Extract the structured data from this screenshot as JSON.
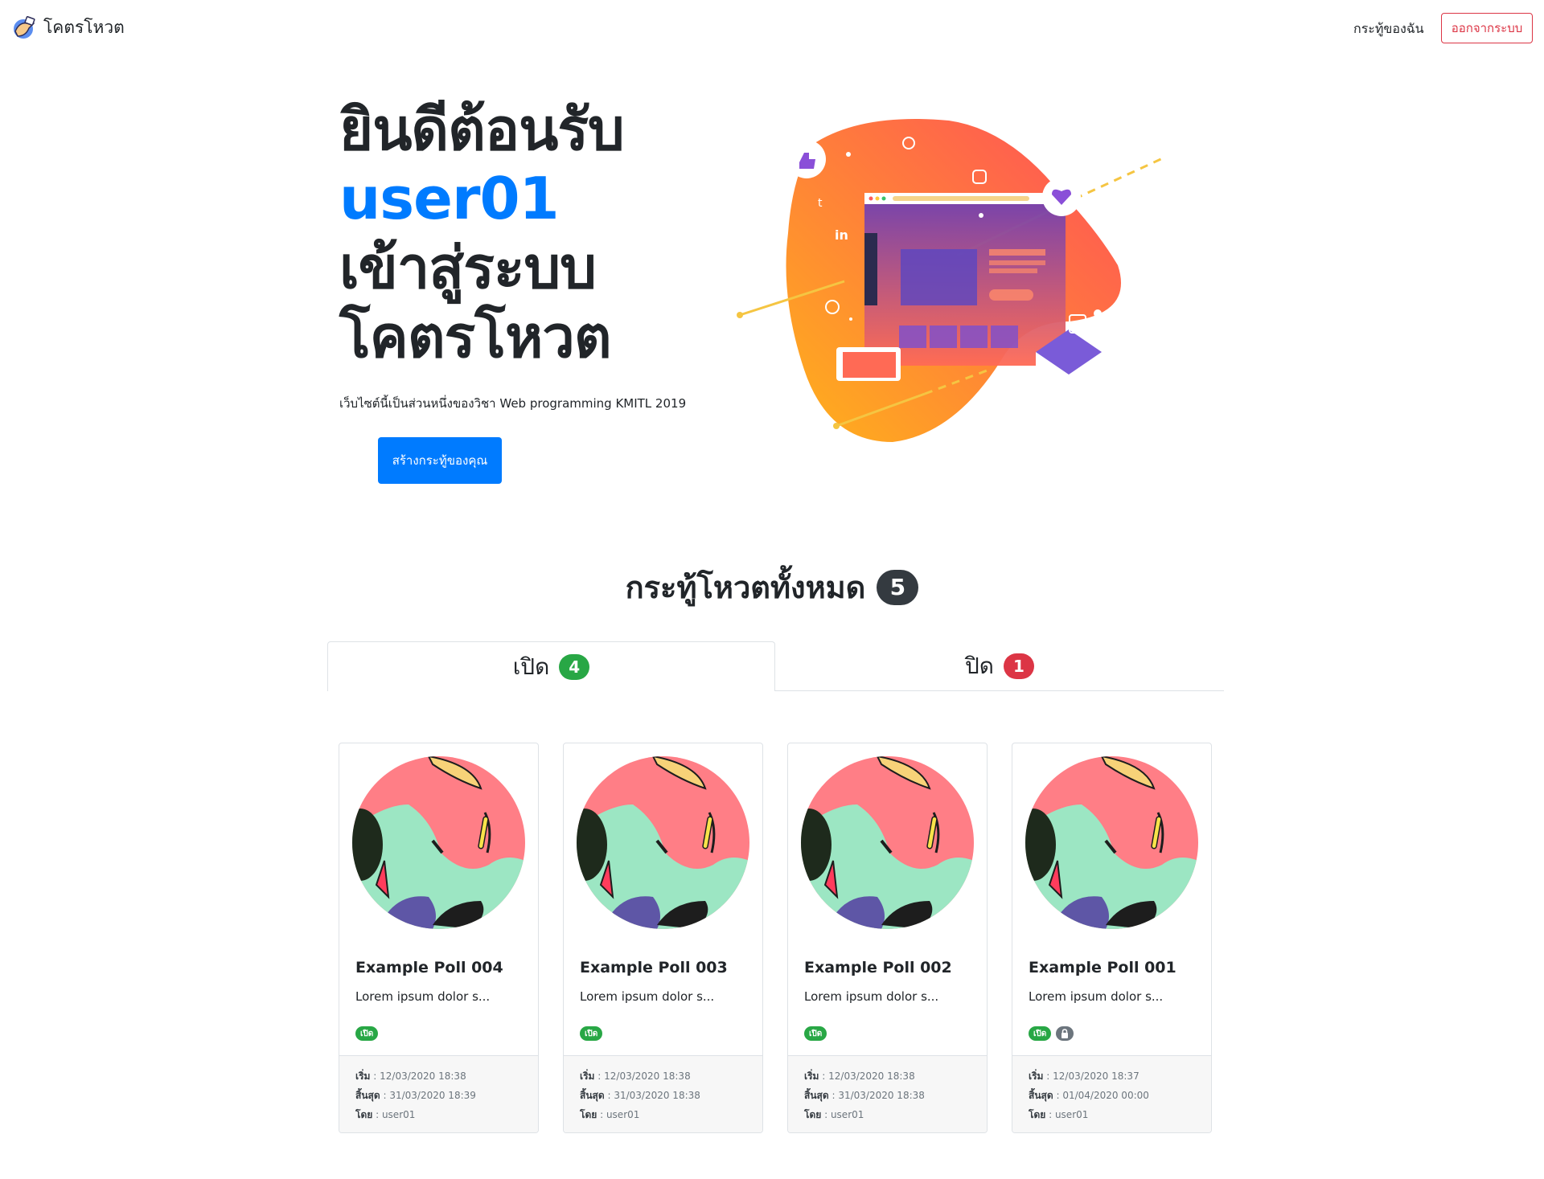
{
  "navbar": {
    "brand": "โคตรโหวต",
    "my_polls": "กระทู้ของฉัน",
    "logout": "ออกจากระบบ"
  },
  "hero": {
    "line1": "ยินดีต้อนรับ",
    "username": "user01",
    "line3": "เข้าสู่ระบบ",
    "line4": "โคตรโหวต",
    "subtitle": "เว็บไซต์นี้เป็นส่วนหนึ่งของวิชา Web programming KMITL 2019",
    "create_button": "สร้างกระทู้ของคุณ"
  },
  "section": {
    "title": "กระทู้โหวตทั้งหมด",
    "total": "5"
  },
  "tabs": [
    {
      "label": "เปิด",
      "count": "4",
      "color": "#28a745"
    },
    {
      "label": "ปิด",
      "count": "1",
      "color": "#dc3545"
    }
  ],
  "polls": [
    {
      "title": "Example Poll 004",
      "desc": "Lorem ipsum dolor s...",
      "status": "เปิด",
      "locked": false,
      "start_label": "เริ่ม",
      "start": "12/03/2020 18:38",
      "end_label": "สิ้นสุด",
      "end": "31/03/2020 18:39",
      "by_label": "โดย",
      "by": "user01"
    },
    {
      "title": "Example Poll 003",
      "desc": "Lorem ipsum dolor s...",
      "status": "เปิด",
      "locked": false,
      "start_label": "เริ่ม",
      "start": "12/03/2020 18:38",
      "end_label": "สิ้นสุด",
      "end": "31/03/2020 18:38",
      "by_label": "โดย",
      "by": "user01"
    },
    {
      "title": "Example Poll 002",
      "desc": "Lorem ipsum dolor s...",
      "status": "เปิด",
      "locked": false,
      "start_label": "เริ่ม",
      "start": "12/03/2020 18:38",
      "end_label": "สิ้นสุด",
      "end": "31/03/2020 18:38",
      "by_label": "โดย",
      "by": "user01"
    },
    {
      "title": "Example Poll 001",
      "desc": "Lorem ipsum dolor s...",
      "status": "เปิด",
      "locked": true,
      "start_label": "เริ่ม",
      "start": "12/03/2020 18:37",
      "end_label": "สิ้นสุด",
      "end": "01/04/2020 00:00",
      "by_label": "โดย",
      "by": "user01"
    }
  ],
  "colors": {
    "primary": "#007bff",
    "danger": "#dc3545",
    "success": "#28a745",
    "dark": "#343a40"
  },
  "icons": {
    "brand": "vote-hand-icon",
    "lock": "lock-icon"
  }
}
